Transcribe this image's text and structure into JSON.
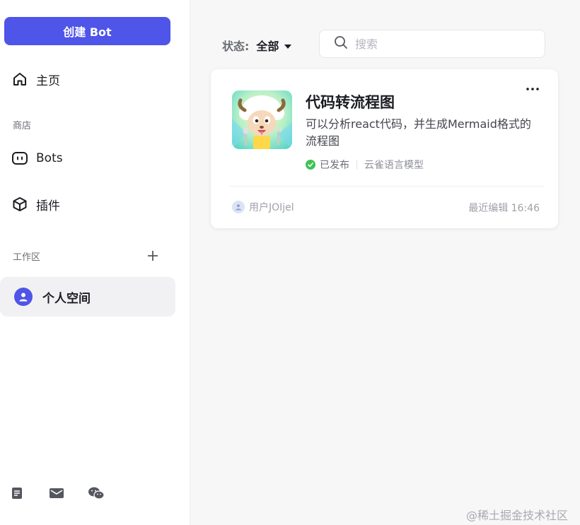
{
  "sidebar": {
    "create_button": "创建 Bot",
    "nav": {
      "home": "主页",
      "bots": "Bots",
      "plugins": "插件"
    },
    "store_label": "商店",
    "workspace_label": "工作区",
    "personal_space": "个人空间",
    "bottom_icons": [
      "document-icon",
      "mail-icon",
      "wechat-icon"
    ]
  },
  "filter": {
    "label": "状态:",
    "value": "全部"
  },
  "search": {
    "placeholder": "搜索"
  },
  "bot_card": {
    "title": "代码转流程图",
    "description": "可以分析react代码，并生成Mermaid格式的流程图",
    "status": "已发布",
    "model": "云雀语言模型",
    "owner": "用户JOIjel",
    "edited": "最近编辑 16:46"
  },
  "watermark": "@稀土掘金技术社区",
  "colors": {
    "accent": "#4e55e8",
    "published": "#3ec254"
  }
}
